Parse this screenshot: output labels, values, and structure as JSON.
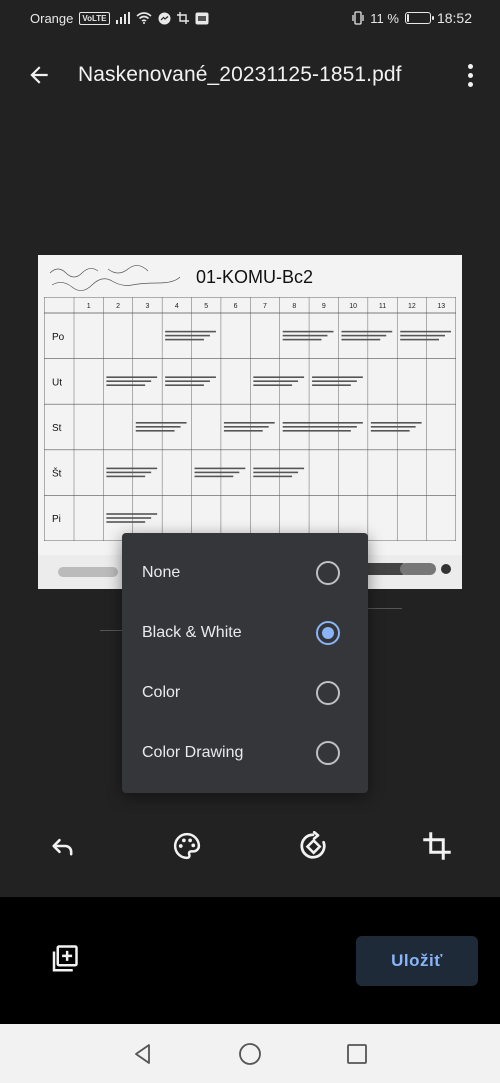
{
  "status_bar": {
    "carrier": "Orange",
    "volte": "VoLTE",
    "battery_percent": "11 %",
    "battery_level": 0.11,
    "time": "18:52"
  },
  "app_bar": {
    "title": "Naskenované_20231125-1851.pdf",
    "back_icon": "arrow-left-icon",
    "more_icon": "more-vert-icon"
  },
  "document": {
    "header": "01-KOMU-Bc2",
    "days": [
      "Po",
      "Ut",
      "St",
      "Št",
      "Pi"
    ],
    "columns": [
      "1",
      "2",
      "3",
      "4",
      "5",
      "6",
      "7",
      "8",
      "9",
      "10",
      "11",
      "12",
      "13"
    ]
  },
  "color_menu": {
    "options": [
      {
        "label": "None",
        "selected": false
      },
      {
        "label": "Black & White",
        "selected": true
      },
      {
        "label": "Color",
        "selected": false
      },
      {
        "label": "Color Drawing",
        "selected": false
      }
    ]
  },
  "toolbar": {
    "undo_icon": "undo-icon",
    "palette_icon": "palette-icon",
    "rotate_icon": "rotate-icon",
    "crop_icon": "crop-icon"
  },
  "bottom": {
    "add_page_icon": "add-page-icon",
    "save_label": "Uložiť"
  },
  "nav": {
    "back_icon": "nav-back-icon",
    "home_icon": "nav-home-icon",
    "recents_icon": "nav-recents-icon"
  },
  "colors": {
    "background": "#222222",
    "accent": "#8ab4f8",
    "menu_bg": "#35363a",
    "save_bg": "#1f2a38"
  }
}
